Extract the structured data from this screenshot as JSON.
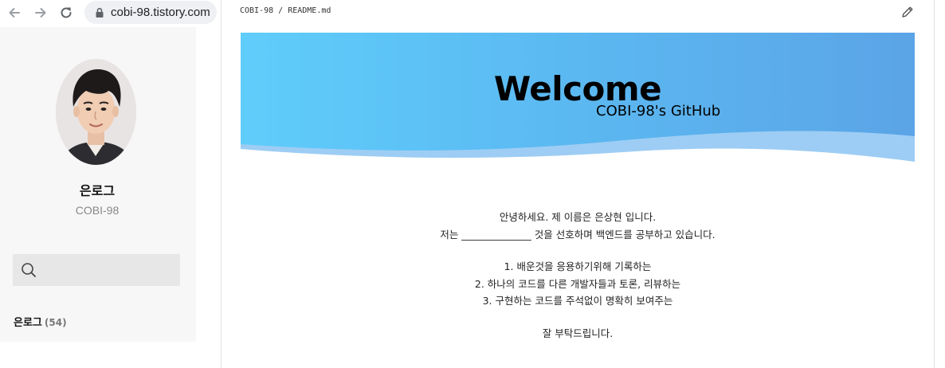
{
  "browser": {
    "url": "cobi-98.tistory.com",
    "icons": [
      "back-arrow-icon",
      "forward-arrow-icon",
      "reload-icon",
      "lock-icon"
    ]
  },
  "sidebar": {
    "blog_name": "은로그",
    "blog_id": "COBI-98",
    "search_icon": "search-icon",
    "category": {
      "label": "은로그",
      "count": "(54)"
    }
  },
  "readme": {
    "path": "COBI-98 / README.md",
    "edit_icon": "pencil-icon",
    "banner": {
      "title": "Welcome",
      "subtitle": "COBI-98's GitHub",
      "colors": {
        "start": "#5fcdfb",
        "end": "#5ba4e6",
        "wave": "#9dcdf4"
      }
    },
    "intro": {
      "line1": "안녕하세요. 제 이름은 은상현 입니다.",
      "line2": "저는 ______________ 것을 선호하며 백엔드를 공부하고 있습니다.",
      "items": [
        "1. 배운것을 응용하기위해 기록하는",
        "2. 하나의 코드를 다른 개발자들과 토론, 리뷰하는",
        "3. 구현하는 코드를 주석없이 명확히 보여주는"
      ],
      "closing": "잘 부탁드립니다."
    }
  }
}
